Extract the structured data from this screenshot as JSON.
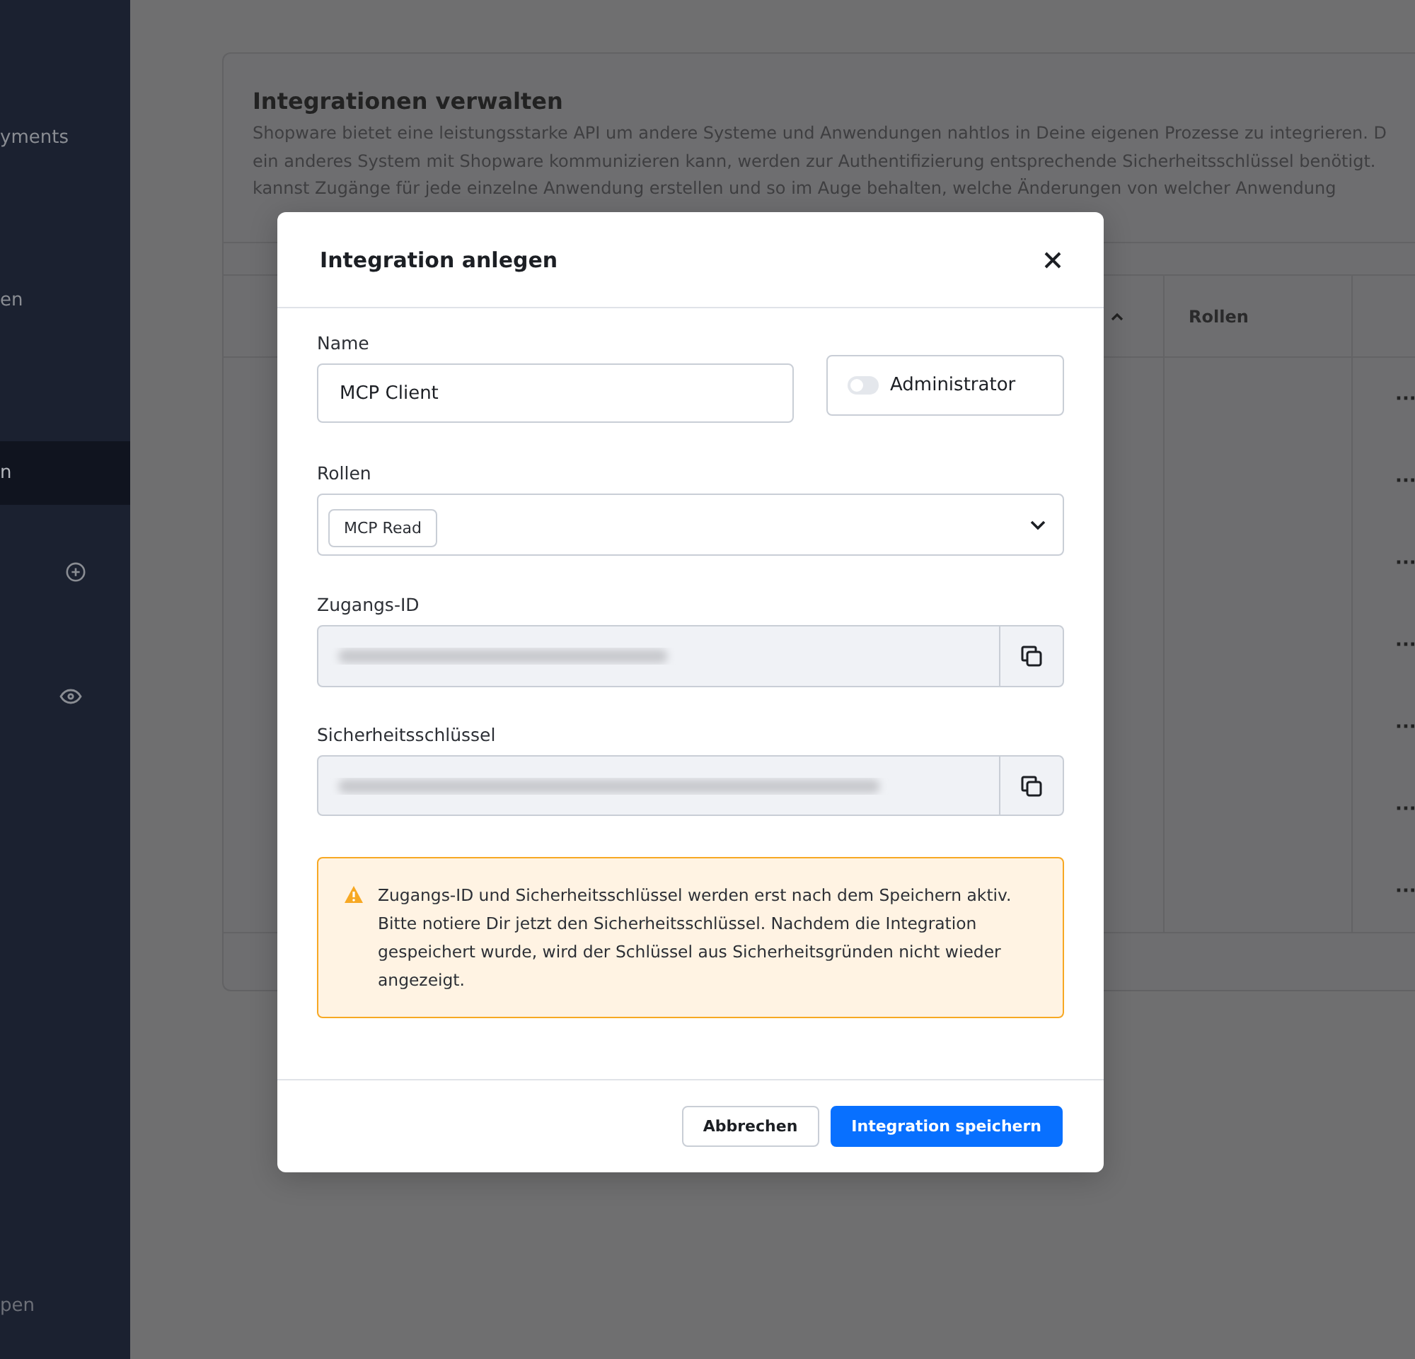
{
  "sidebar": {
    "items": [
      {
        "label": "yments",
        "selected": false
      },
      {
        "label": "en",
        "selected": false
      },
      {
        "label": "n",
        "selected": true
      }
    ],
    "footer": "pen"
  },
  "card": {
    "title": "Integrationen verwalten",
    "description": [
      "Shopware bietet eine leistungsstarke API um andere Systeme und Anwendungen nahtlos in Deine eigenen Prozesse zu integrieren. D",
      "ein anderes System mit Shopware kommunizieren kann, werden zur Authentifizierung entsprechende Sicherheitsschlüssel benötigt.",
      "kannst Zugänge für jede einzelne Anwendung erstellen und so im Auge behalten, welche Änderungen von welcher Anwendung"
    ]
  },
  "table": {
    "roles_column": "Rollen",
    "rows": [
      {
        "action": "···"
      },
      {
        "action": "···"
      },
      {
        "action": "···"
      },
      {
        "action": "···"
      },
      {
        "action": "···"
      },
      {
        "action": "···"
      },
      {
        "action": "···"
      }
    ]
  },
  "dialog": {
    "title": "Integration anlegen",
    "name": {
      "label": "Name",
      "value": "MCP Client"
    },
    "admin": {
      "label": "Administrator",
      "on": false
    },
    "roles": {
      "label": "Rollen",
      "tags": [
        "MCP Read"
      ]
    },
    "access_id": {
      "label": "Zugangs-ID"
    },
    "secret": {
      "label": "Sicherheitsschlüssel"
    },
    "warning": "Zugangs-ID und Sicherheitsschlüssel werden erst nach dem Speichern aktiv. Bitte notiere Dir jetzt den Sicherheitsschlüssel. Nachdem die Integration gespeichert wurde, wird der Schlüssel aus Sicherheitsgründen nicht wieder angezeigt.",
    "buttons": [
      {
        "label": "Abbrechen",
        "kind": "secondary"
      },
      {
        "label": "Integration speichern",
        "kind": "primary"
      }
    ]
  }
}
